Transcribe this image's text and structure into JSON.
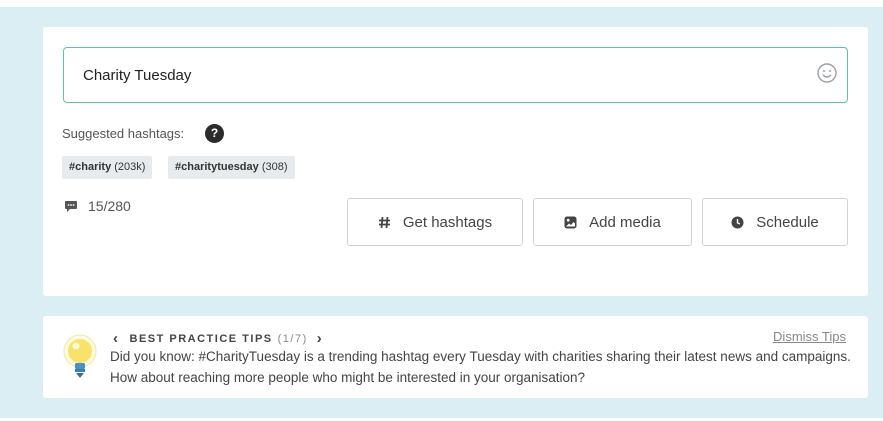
{
  "composer": {
    "text": "Charity Tuesday",
    "emoji_icon": "smiley-icon"
  },
  "suggestions": {
    "label": "Suggested hashtags:",
    "help": "?",
    "tags": [
      {
        "name": "#charity",
        "count": "(203k)"
      },
      {
        "name": "#charitytuesday",
        "count": "(308)"
      }
    ]
  },
  "counter": {
    "icon": "speech-bubble-icon",
    "text": "15/280"
  },
  "actions": {
    "get_hashtags": "Get hashtags",
    "add_media": "Add media",
    "schedule": "Schedule"
  },
  "tips": {
    "title": "BEST PRACTICE TIPS",
    "page": "(1/7)",
    "dismiss": "Dismiss Tips",
    "body": "Did you know: #CharityTuesday is a trending hashtag every Tuesday with charities sharing their latest news and campaigns. How about reaching more people who might be interested in your organisation?"
  },
  "colors": {
    "background": "#daeef3",
    "accent": "#5cc3a6",
    "bulb": "#f7e36b"
  }
}
